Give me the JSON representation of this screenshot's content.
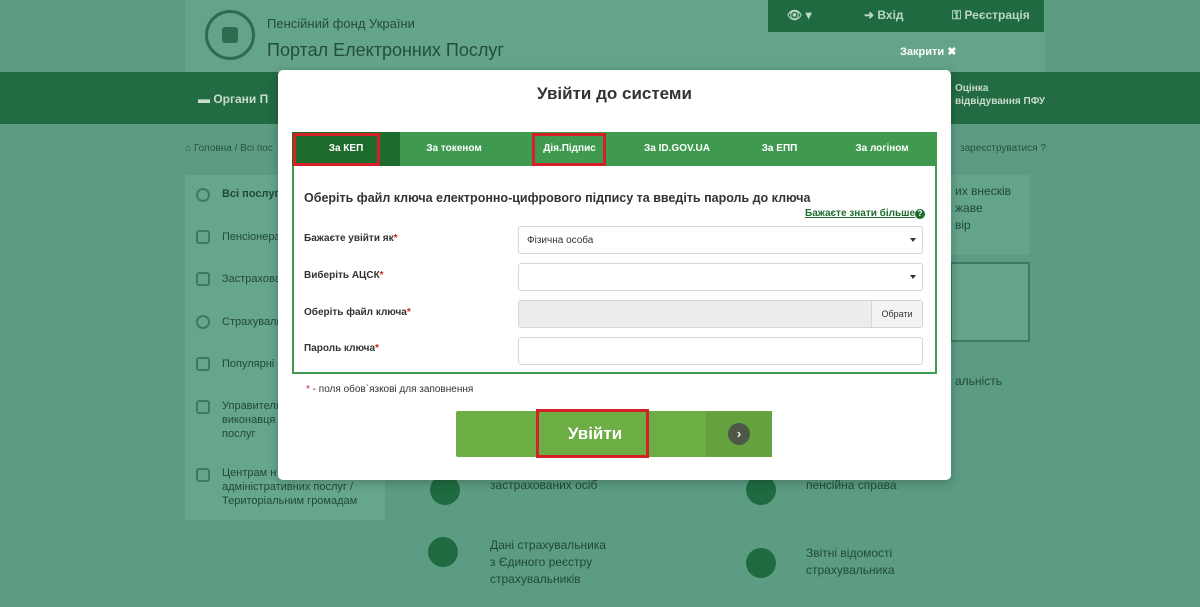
{
  "header": {
    "fund_name": "Пенсійний фонд України",
    "portal_name": "Портал Електронних Послуг",
    "login": "Вхід",
    "register": "Реєстрація",
    "close": "Закрити ✖"
  },
  "nav": {
    "item1": "Органи П",
    "item2_line1": "Оцінка",
    "item2_line2": "відвідування ПФУ"
  },
  "breadcrumb": "Головна / Всі пос",
  "register_link": "зареєструватися",
  "sidebar": {
    "items": [
      {
        "label": "Всі послуги"
      },
      {
        "label": "Пенсіонера"
      },
      {
        "label": "Застрахова"
      },
      {
        "label": "Страхувальн"
      },
      {
        "label": "Популярні п"
      },
      {
        "label": "Управителя\nвиконавця\nпослуг"
      },
      {
        "label": "Центрам н\nадміністративних послуг /\nТериторіальним громадам"
      }
    ]
  },
  "cards": {
    "top_right": "их внесків\nжаве\nвір",
    "mid_right": "альність",
    "insured": "застрахованих осіб",
    "pension": "пенсійна справа",
    "employer_data": "Дані страхувальника\nз Єдиного реєстру\nстрахувальників",
    "reports": "Звітні відомості\nстрахувальника"
  },
  "modal": {
    "title": "Увійти до системи",
    "tabs": [
      {
        "label": "За КЕП"
      },
      {
        "label": "За токеном"
      },
      {
        "label": "Дія.Підпис"
      },
      {
        "label": "За ID.GOV.UA"
      },
      {
        "label": "За ЕПП"
      },
      {
        "label": "За логіном"
      }
    ],
    "instruction": "Оберіть файл ключа електронно-цифрового підпису та введіть пароль до ключа",
    "learn_more": "Бажаєте знати більше",
    "fields": {
      "login_as_label": "Бажаєте увійти як",
      "login_as_value": "Фізична особа",
      "acsk_label": "Виберіть АЦСК",
      "acsk_value": "",
      "key_file_label": "Оберіть файл ключа",
      "choose_button": "Обрати",
      "password_label": "Пароль ключа",
      "password_value": ""
    },
    "required_mark": "*",
    "required_note": " - поля обов`язкові для заповнення",
    "submit": "Увійти",
    "submit_arrow": "›"
  },
  "colors": {
    "tab_bg": "#3f9a4f",
    "tab_active": "#1e6b2e",
    "highlight": "#d42027",
    "submit": "#6cae43"
  }
}
